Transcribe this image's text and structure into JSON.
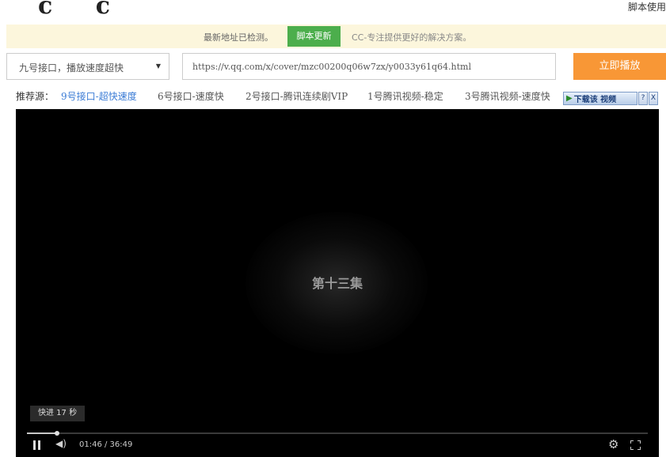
{
  "header": {
    "logo": "c c",
    "help_link": "脚本使用"
  },
  "notice": {
    "text": "最新地址已检测。",
    "button_label": "脚本更新",
    "tagline": "CC-专注提供更好的解决方案。"
  },
  "controls": {
    "interface_selected": "九号接口，播放速度超快",
    "url_value": "https://v.qq.com/x/cover/mzc00200q06w7zx/y0033y61q64.html",
    "play_button": "立即播放"
  },
  "recommend": {
    "label": "推荐源：",
    "items": [
      {
        "label": "9号接口-超快速度"
      },
      {
        "label": "6号接口-速度快"
      },
      {
        "label": "2号接口-腾讯连续剧VIP"
      },
      {
        "label": "1号腾讯视频-稳定"
      },
      {
        "label": "3号腾讯视频-速度快"
      }
    ]
  },
  "download_bar": {
    "label": "下载该 视频",
    "help": "?",
    "close": "X"
  },
  "player": {
    "episode_title": "第十三集",
    "toast": "快进 17 秒",
    "time_display": "01:46 / 36:49",
    "progress_fraction": 0.048
  },
  "colors": {
    "notice_bg": "#fcf6dc",
    "update_button": "#4cae4c",
    "play_button": "#f89736",
    "active_link": "#3a7bd5"
  }
}
